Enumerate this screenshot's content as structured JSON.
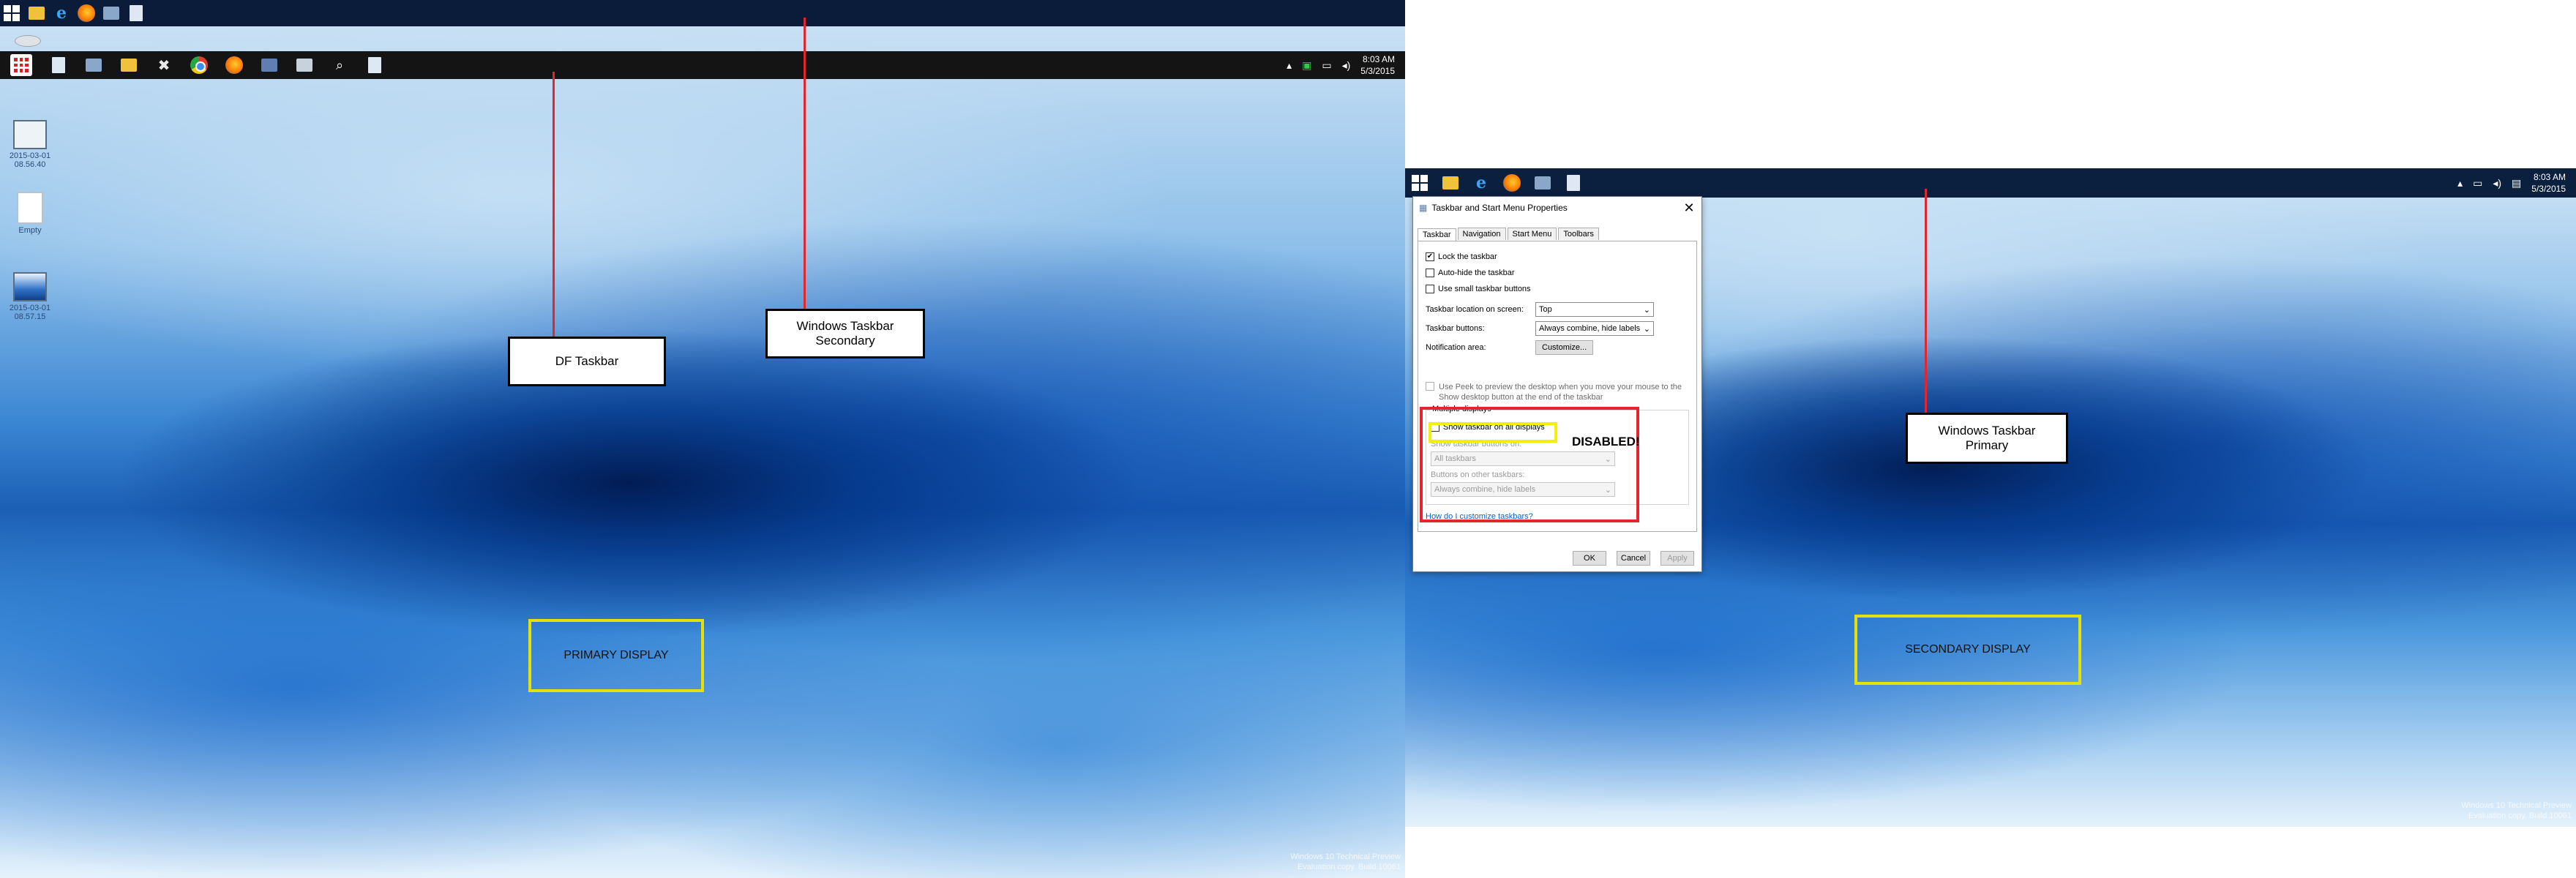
{
  "primary_display": {
    "windows_taskbar_secondary": {
      "icons": [
        "windows-start-icon",
        "file-explorer-icon",
        "internet-explorer-icon",
        "firefox-icon",
        "app-icon",
        "document-icon"
      ]
    },
    "df_taskbar": {
      "icons": [
        "df-start-icon",
        "notepad-icon",
        "printer-icon",
        "folder-icon",
        "tools-icon",
        "chrome-icon",
        "firefox-icon",
        "network-app-icon",
        "printer-icon",
        "search-icon",
        "document-icon"
      ],
      "tray": {
        "time": "8:03 AM",
        "date": "5/3/2015"
      }
    },
    "desktop_icons": [
      {
        "label": "2015-03-01 08.56.40"
      },
      {
        "label": "Empty"
      },
      {
        "label": "2015-03-01 08.57.15"
      }
    ],
    "callouts": {
      "df_taskbar": "DF Taskbar",
      "windows_taskbar_secondary": "Windows Taskbar\n  Secondary"
    },
    "display_label": "PRIMARY DISPLAY",
    "watermark": "Windows 10 Technical Preview\nEvaluation copy. Build 10061"
  },
  "secondary_display": {
    "windows_taskbar_primary": {
      "icons": [
        "windows-start-icon",
        "file-explorer-icon",
        "internet-explorer-icon",
        "firefox-icon",
        "app-icon",
        "document-icon"
      ],
      "tray": {
        "time": "8:03 AM",
        "date": "5/3/2015"
      }
    },
    "callouts": {
      "windows_taskbar_primary": "Windows Taskbar\n  Primary"
    },
    "display_label": "SECONDARY DISPLAY",
    "watermark": "Windows 10 Technical Preview\nEvaluation copy. Build 10061"
  },
  "dialog": {
    "title": "Taskbar and Start Menu Properties",
    "tabs": [
      "Taskbar",
      "Navigation",
      "Start Menu",
      "Toolbars"
    ],
    "active_tab": "Taskbar",
    "checkboxes": [
      {
        "label": "Lock the taskbar",
        "checked": true
      },
      {
        "label": "Auto-hide the taskbar",
        "checked": false
      },
      {
        "label": "Use small taskbar buttons",
        "checked": false
      }
    ],
    "location_label": "Taskbar location on screen:",
    "location_value": "Top",
    "buttons_label": "Taskbar buttons:",
    "buttons_value": "Always combine, hide labels",
    "notification_label": "Notification area:",
    "customize_button": "Customize...",
    "peek_text": "Use Peek to preview the desktop when you move your mouse to the Show desktop button at the end of the taskbar",
    "multiple_displays": {
      "title": "Multiple displays",
      "show_all": "Show taskbar on all displays",
      "show_buttons_label": "Show taskbar buttons on:",
      "show_buttons_value": "All taskbars",
      "other_buttons_label": "Buttons on other taskbars:",
      "other_buttons_value": "Always combine, hide labels"
    },
    "help_link": "How do I customize taskbars?",
    "ok": "OK",
    "cancel": "Cancel",
    "apply": "Apply",
    "annotation": "DISABLED!"
  },
  "colors": {
    "annotation_red": "#e1262d",
    "annotation_yellow": "#f3ef0d",
    "taskbar_dark": "#0a1c3a"
  }
}
